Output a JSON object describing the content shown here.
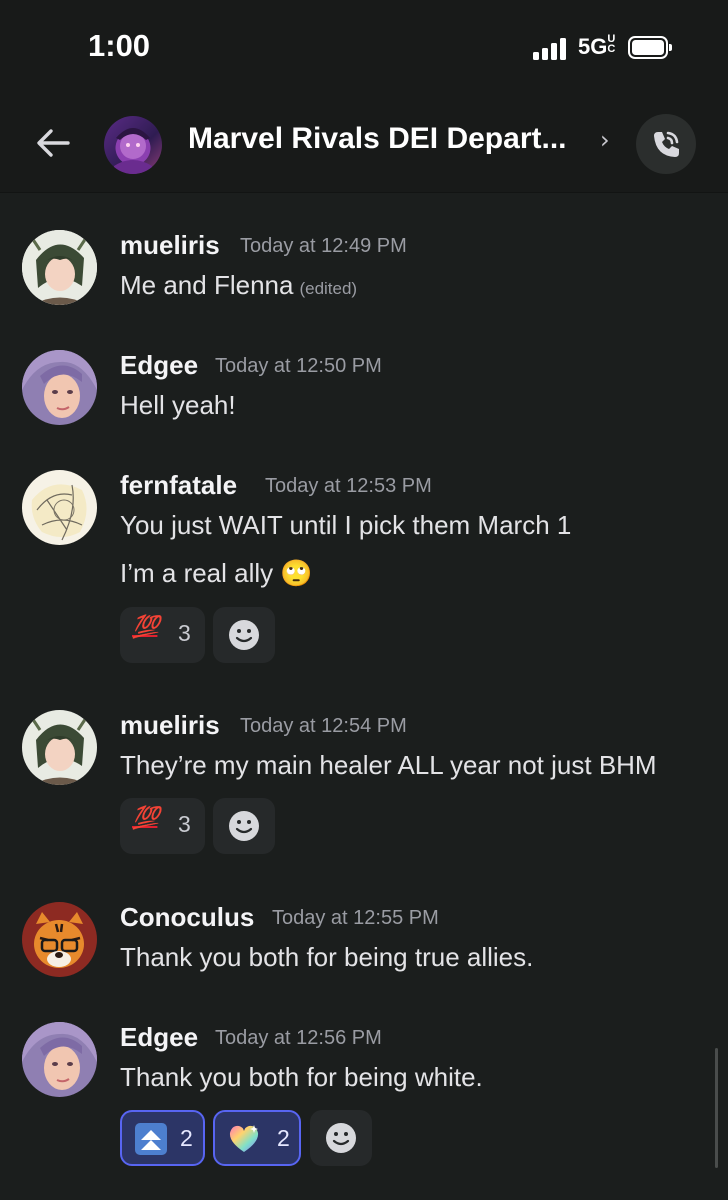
{
  "status": {
    "time": "1:00",
    "network": "5G",
    "network_suffix": "UC"
  },
  "header": {
    "title": "Marvel Rivals DEI Depart...",
    "chevron": "›"
  },
  "messages": [
    {
      "username": "mueliris",
      "timestamp": "Today at 12:49 PM",
      "lines": [
        "Me and Flenna"
      ],
      "edited": "(edited)"
    },
    {
      "username": "Edgee",
      "timestamp": "Today at 12:50 PM",
      "lines": [
        "Hell yeah!"
      ]
    },
    {
      "username": "fernfatale",
      "timestamp": "Today at 12:53 PM",
      "lines": [
        "You just WAIT until I pick them March 1",
        "I’m a real ally 🙄"
      ],
      "reactions": [
        {
          "emoji": "💯",
          "count": "3"
        }
      ]
    },
    {
      "username": "mueliris",
      "timestamp": "Today at 12:54 PM",
      "lines": [
        "They’re my main healer ALL year not just BHM"
      ],
      "reactions": [
        {
          "emoji": "💯",
          "count": "3"
        }
      ]
    },
    {
      "username": "Conoculus",
      "timestamp": "Today at 12:55 PM",
      "lines": [
        "Thank you both for being true allies."
      ]
    },
    {
      "username": "Edgee",
      "timestamp": "Today at 12:56 PM",
      "lines": [
        "Thank you both for being white."
      ],
      "reactions": [
        {
          "emoji": "⏫",
          "count": "2"
        },
        {
          "emoji": "💖",
          "count": "2"
        }
      ]
    }
  ],
  "icons": {
    "back": "arrow-left-icon",
    "call": "phone-call-icon",
    "add_reaction": "add-reaction-icon"
  },
  "colors": {
    "background": "#1b1e1d",
    "reaction_selected": "#5865f2",
    "hundred": "#e0202f"
  }
}
